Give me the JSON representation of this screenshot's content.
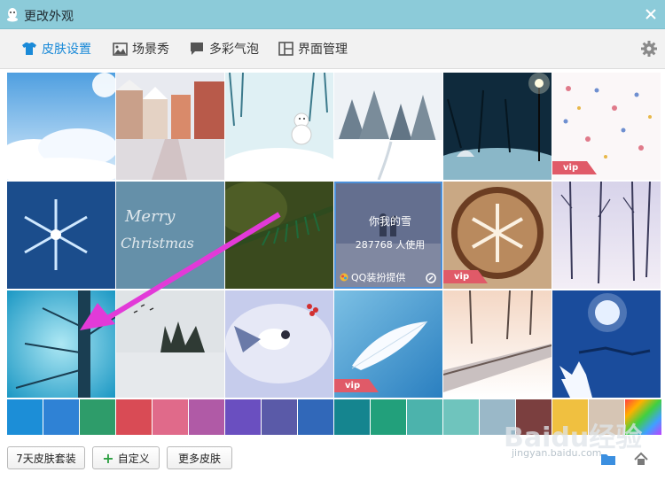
{
  "window": {
    "title": "更改外观",
    "close_icon": "close-icon"
  },
  "tabs": [
    {
      "label": "皮肤设置",
      "icon": "shirt-icon",
      "active": true
    },
    {
      "label": "场景秀",
      "icon": "picture-icon",
      "active": false
    },
    {
      "label": "多彩气泡",
      "icon": "speech-bubble-icon",
      "active": false
    },
    {
      "label": "界面管理",
      "icon": "layout-icon",
      "active": false
    }
  ],
  "settings_icon": "gear-icon",
  "skins": [
    {
      "row": 0,
      "col": 0,
      "theme": "sky-clouds",
      "vip": false
    },
    {
      "row": 0,
      "col": 1,
      "theme": "snowy-street",
      "vip": false
    },
    {
      "row": 0,
      "col": 2,
      "theme": "snowman",
      "vip": false
    },
    {
      "row": 0,
      "col": 3,
      "theme": "snow-forest",
      "vip": false
    },
    {
      "row": 0,
      "col": 4,
      "theme": "night-lamp",
      "vip": false
    },
    {
      "row": 0,
      "col": 5,
      "theme": "floral-pattern",
      "vip": true
    },
    {
      "row": 1,
      "col": 0,
      "theme": "snowflake-blue",
      "vip": false
    },
    {
      "row": 1,
      "col": 1,
      "theme": "merry-christmas",
      "vip": false
    },
    {
      "row": 1,
      "col": 2,
      "theme": "pine-branch",
      "vip": false
    },
    {
      "row": 1,
      "col": 3,
      "theme": "your-snow",
      "vip": false,
      "hovered": true
    },
    {
      "row": 1,
      "col": 4,
      "theme": "latte-snowflake",
      "vip": true
    },
    {
      "row": 1,
      "col": 5,
      "theme": "purple-trees",
      "vip": false
    },
    {
      "row": 2,
      "col": 0,
      "theme": "blue-branches",
      "vip": false
    },
    {
      "row": 2,
      "col": 1,
      "theme": "snowy-lake",
      "vip": false
    },
    {
      "row": 2,
      "col": 2,
      "theme": "bird-berries",
      "vip": false
    },
    {
      "row": 2,
      "col": 3,
      "theme": "feather",
      "vip": true
    },
    {
      "row": 2,
      "col": 4,
      "theme": "snowy-path",
      "vip": false
    },
    {
      "row": 2,
      "col": 5,
      "theme": "moon-reindeer",
      "vip": false
    }
  ],
  "vip_label": "vip",
  "hover_card": {
    "name": "你我的雪",
    "users": "287768 人使用",
    "provider": "QQ装扮提供"
  },
  "swatch_colors": [
    "#1c8ed7",
    "#2f82d5",
    "#2e9c6a",
    "#d94b55",
    "#e06a8a",
    "#b05aa6",
    "#6a4fc0",
    "#5a5aa8",
    "#3168b9",
    "#15858f",
    "#22a07b",
    "#4cb3ac",
    "#6fc4bd",
    "#9ab8c8",
    "#7b3f3f",
    "#f0c040",
    "#d6c5b4",
    "rainbow"
  ],
  "footer": {
    "btn_7day": "7天皮肤套装",
    "btn_custom": "自定义",
    "btn_more": "更多皮肤",
    "folder_icon": "folder-icon",
    "restore_icon": "restore-icon"
  },
  "watermark": {
    "brand": "Baidu经验",
    "url": "jingyan.baidu.com"
  }
}
